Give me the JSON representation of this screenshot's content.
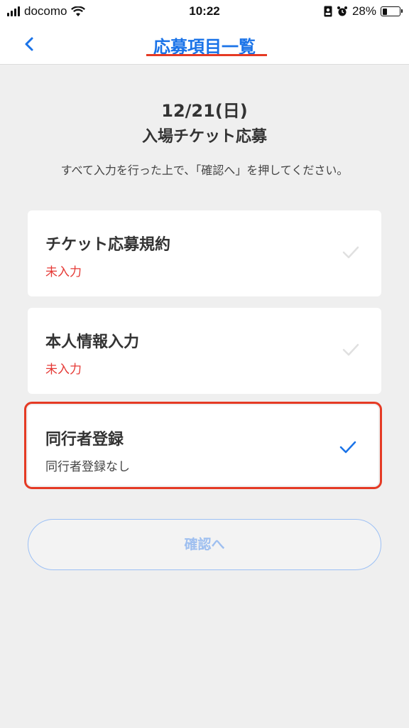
{
  "status_bar": {
    "carrier": "docomo",
    "time": "10:22",
    "battery": "28%",
    "battery_level": 0.28
  },
  "nav": {
    "title": "応募項目一覧",
    "back_icon": "chevron-left-icon"
  },
  "header": {
    "date": "12/21(日)",
    "event": "入場チケット応募",
    "instruction": "すべて入力を行った上で、「確認へ」を押してください。"
  },
  "items": [
    {
      "title": "チケット応募規約",
      "status": "未入力",
      "completed": false
    },
    {
      "title": "本人情報入力",
      "status": "未入力",
      "completed": false
    },
    {
      "title": "同行者登録",
      "status": "同行者登録なし",
      "completed": true
    }
  ],
  "confirm_button": {
    "label": "確認へ"
  },
  "colors": {
    "accent": "#1a73e8",
    "warning": "#e53935",
    "highlight_border": "#e53a24",
    "check_inactive": "#e0e0e0"
  }
}
